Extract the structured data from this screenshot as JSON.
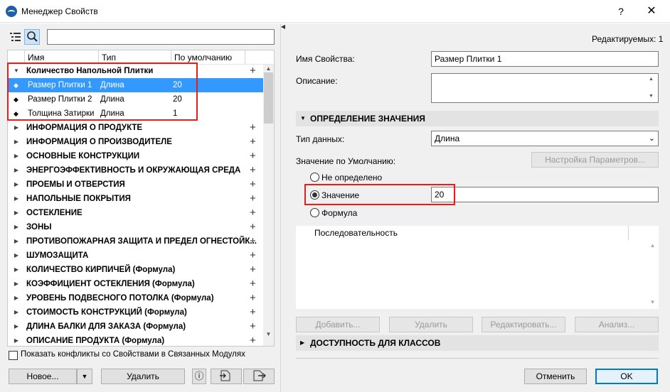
{
  "window": {
    "title": "Менеджер Свойств",
    "help": "?",
    "close": "✕"
  },
  "left": {
    "search_placeholder": "",
    "columns": [
      "Имя",
      "Тип",
      "По умолчанию"
    ],
    "group_open": {
      "name": "Количество Напольной Плитки",
      "plus": "+"
    },
    "items": [
      {
        "name": "Размер Плитки 1",
        "type": "Длина",
        "default": "20",
        "selected": true
      },
      {
        "name": "Размер Плитки 2",
        "type": "Длина",
        "default": "20",
        "selected": false
      },
      {
        "name": "Толщина Затирки",
        "type": "Длина",
        "default": "1",
        "selected": false
      }
    ],
    "groups": [
      "ИНФОРМАЦИЯ О ПРОДУКТЕ",
      "ИНФОРМАЦИЯ О ПРОИЗВОДИТЕЛЕ",
      "ОСНОВНЫЕ КОНСТРУКЦИИ",
      "ЭНЕРГОЭФФЕКТИВНОСТЬ И ОКРУЖАЮЩАЯ СРЕДА",
      "ПРОЕМЫ И ОТВЕРСТИЯ",
      "НАПОЛЬНЫЕ ПОКРЫТИЯ",
      "ОСТЕКЛЕНИЕ",
      "ЗОНЫ",
      "ПРОТИВОПОЖАРНАЯ ЗАЩИТА И ПРЕДЕЛ ОГНЕСТОЙК...",
      "ШУМОЗАЩИТА",
      "КОЛИЧЕСТВО КИРПИЧЕЙ (Формула)",
      "КОЭФФИЦИЕНТ ОСТЕКЛЕНИЯ (Формула)",
      "УРОВЕНЬ ПОДВЕСНОГО ПОТОЛКА (Формула)",
      "СТОИМОСТЬ КОНСТРУКЦИЙ (Формула)",
      "ДЛИНА БАЛКИ ДЛЯ ЗАКАЗА (Формула)",
      "ОПИСАНИЕ ПРОДУКТА (Формула)"
    ],
    "conflicts_label": "Показать конфликты со Свойствами в Связанных Модулях",
    "new_btn": "Новое...",
    "delete_btn": "Удалить",
    "info_icon": "ⓘ"
  },
  "right": {
    "editable": "Редактируемых: 1",
    "prop_name_label": "Имя Свойства:",
    "prop_name_value": "Размер Плитки 1",
    "desc_label": "Описание:",
    "desc_value": "",
    "section_value": "ОПРЕДЕЛЕНИЕ ЗНАЧЕНИЯ",
    "datatype_label": "Тип данных:",
    "datatype_value": "Длина",
    "default_label": "Значение по Умолчанию:",
    "params_btn": "Настройка Параметров...",
    "radio_undefined": "Не определено",
    "radio_value": "Значение",
    "value_input": "20",
    "radio_formula": "Формула",
    "seq_header": "Последовательность",
    "add_btn": "Добавить...",
    "remove_btn": "Удалить",
    "edit_btn": "Редактировать...",
    "analysis_btn": "Анализ...",
    "section_classes": "ДОСТУПНОСТЬ ДЛЯ КЛАССОВ",
    "cancel_btn": "Отменить",
    "ok_btn": "OK"
  },
  "colors": {
    "selection": "#3399ff",
    "highlight": "#e81c1c",
    "accent": "#0078d7"
  }
}
